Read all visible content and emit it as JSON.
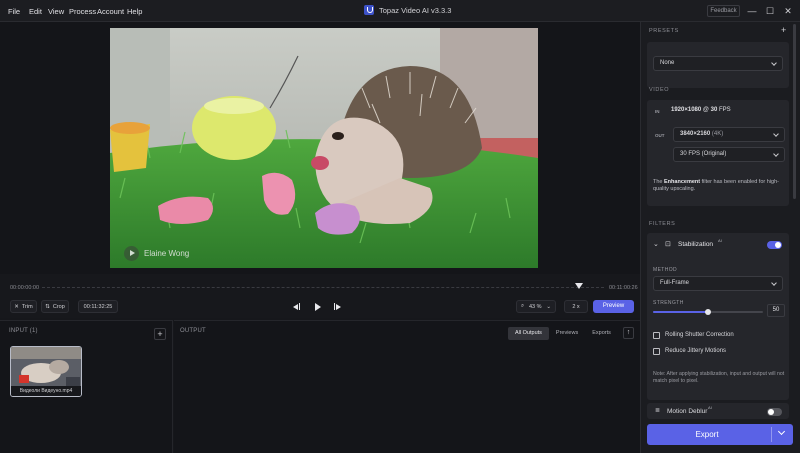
{
  "menu": [
    "File",
    "Edit",
    "View",
    "Process",
    "Account",
    "Help"
  ],
  "app": {
    "title": "Topaz Video AI  v3.3.3",
    "feedback": "Feedback"
  },
  "window_controls": {
    "minimize": "—",
    "maximize": "☐",
    "close": "✕"
  },
  "viewer": {
    "watermark": "Elaine Wong"
  },
  "timeline": {
    "start": "00:00:00:00",
    "end": "00:11:00:26",
    "playhead_fraction": 0.955,
    "trim": "Trim",
    "crop": "Crop",
    "timecode": "00:11:32:25",
    "zoom": "43 %",
    "speed": "2 x",
    "preview": "Preview"
  },
  "input": {
    "label": "INPUT (1)",
    "add": "+",
    "file_name": "Видеоли Видеуно.mp4"
  },
  "output": {
    "label": "OUTPUT",
    "tabs": [
      "All Outputs",
      "Previews",
      "Exports"
    ],
    "up": "↑"
  },
  "presets": {
    "label": "PRESETS",
    "add": "+",
    "value": "None"
  },
  "video": {
    "label": "VIDEO",
    "input_icon": "IN",
    "input_resolution": "1920×1080",
    "input_at": "@",
    "input_fps": "30",
    "input_fps_unit": "FPS",
    "output_icon": "OUT",
    "output_resolution": "3840×2160",
    "output_resolution_tag": "(4K)",
    "output_fps": "30 FPS (Original)",
    "note_prefix": "The",
    "note_bold": "Enhancement",
    "note_suffix": "filter has been enabled for high-quality upscaling."
  },
  "filters": {
    "label": "FILTERS",
    "stabilization": {
      "title": "Stabilization",
      "ai": "AI",
      "enabled": true,
      "method_label": "METHOD",
      "method": "Full-Frame",
      "strength_label": "STRENGTH",
      "strength": 50,
      "rolling_shutter": "Rolling Shutter Correction",
      "jittery": "Reduce Jittery Motions",
      "note": "Note: After applying stabilization, input and output will not match pixel to pixel."
    },
    "motion_deblur": {
      "title": "Motion Deblur",
      "ai": "AI",
      "enabled": false
    }
  },
  "export": {
    "label": "Export"
  },
  "colors": {
    "accent": "#5a62e6",
    "panel": "#1b1c20",
    "background": "#16171b"
  }
}
